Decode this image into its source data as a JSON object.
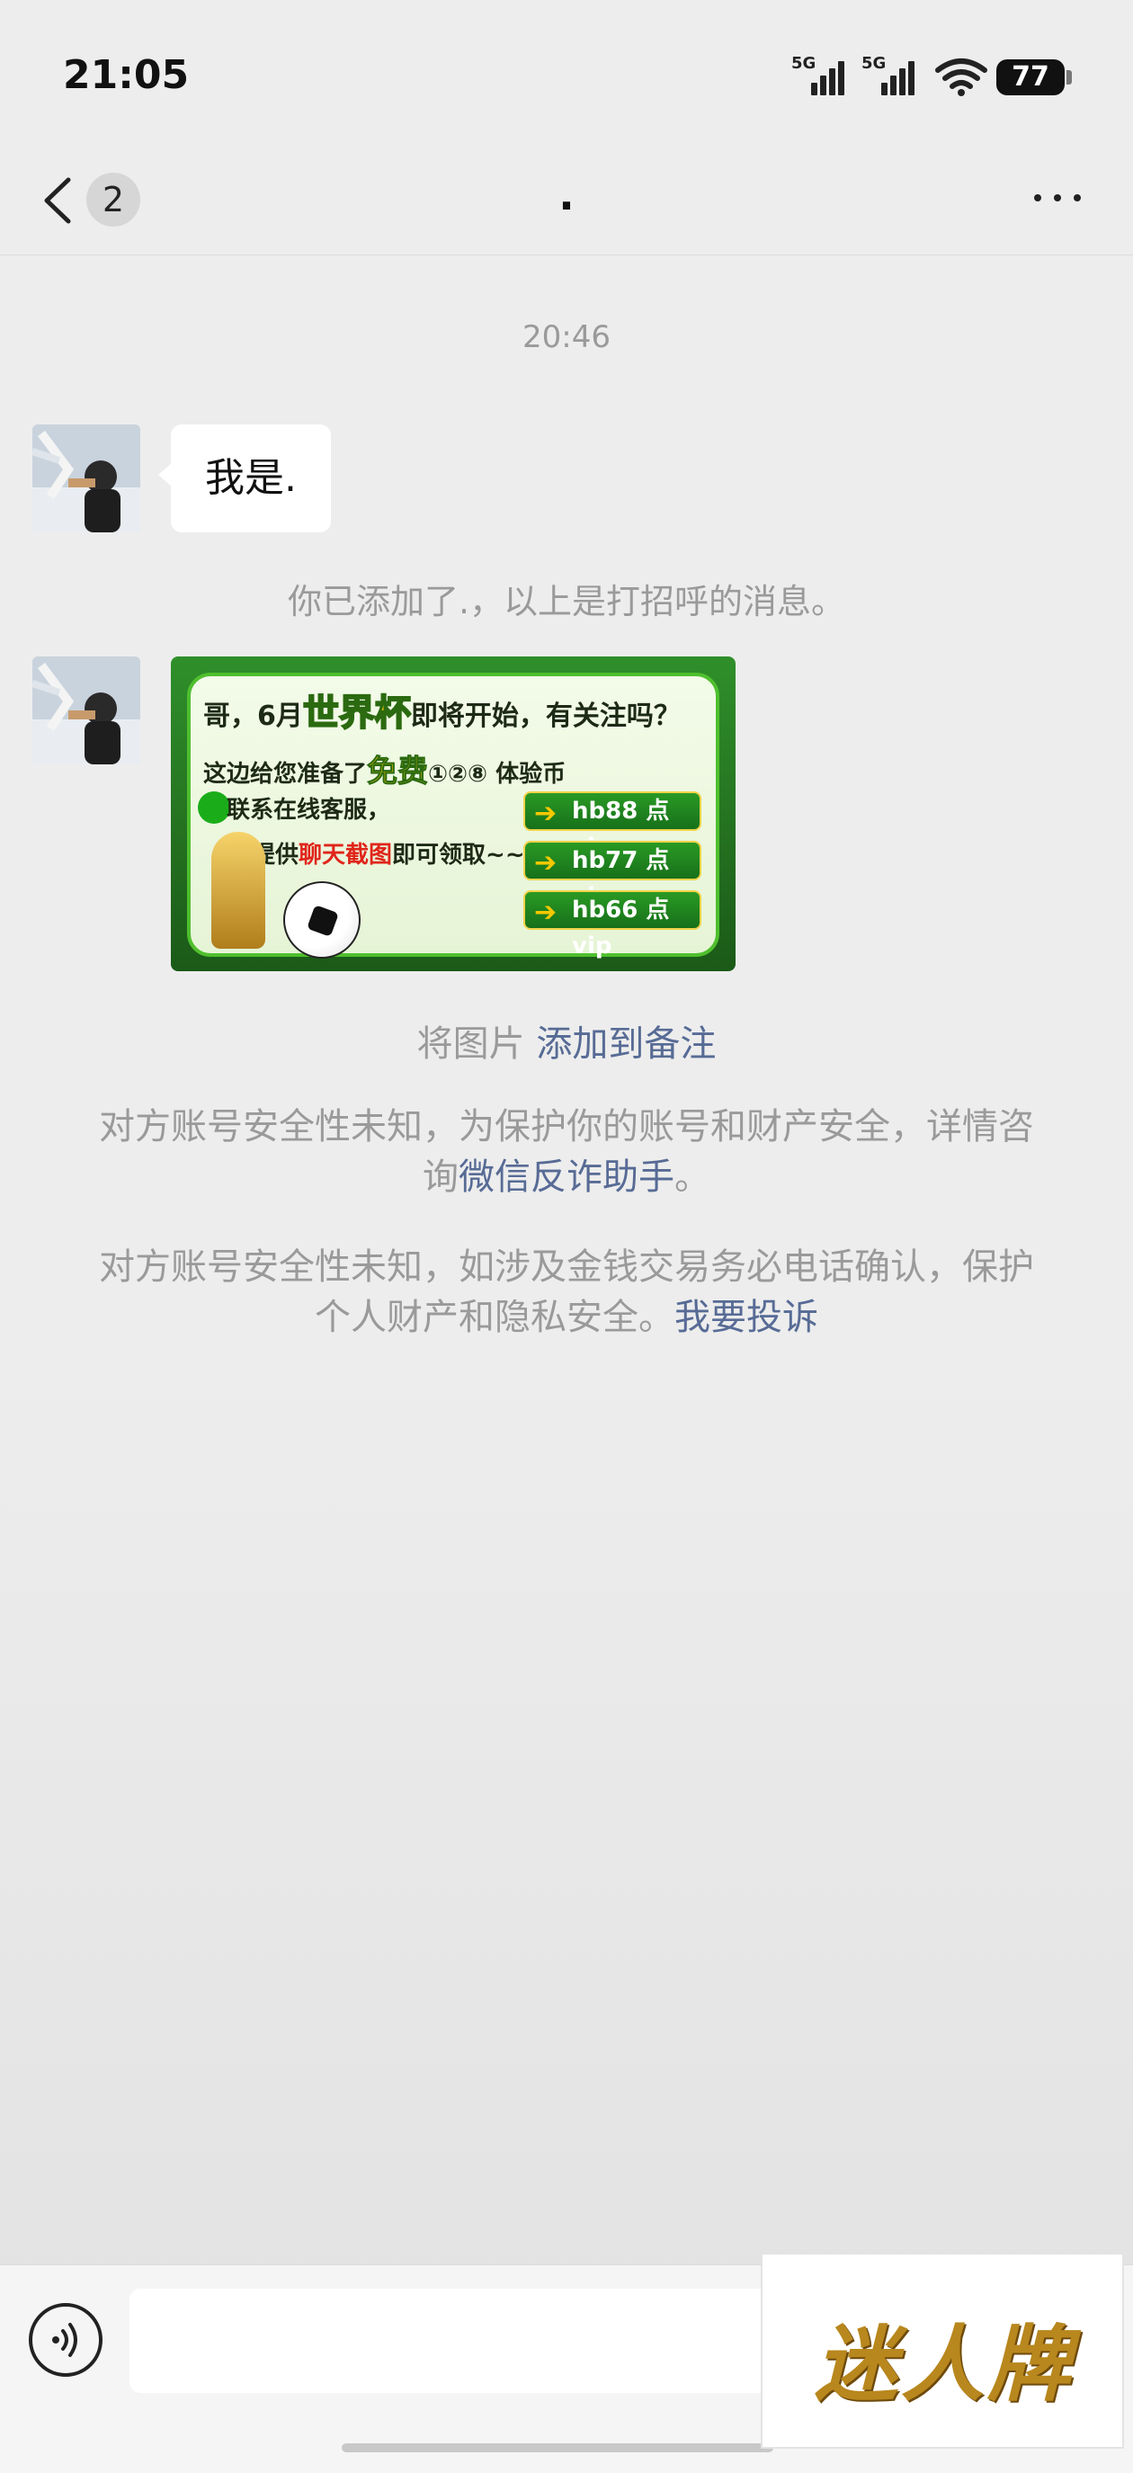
{
  "status_bar": {
    "time": "21:05",
    "network_1": "5G",
    "network_2": "5G",
    "battery": "77"
  },
  "nav": {
    "unread_count": "2",
    "title": "."
  },
  "chat": {
    "timestamp": "20:46",
    "greeting_message": "我是.",
    "added_notice": "你已添加了.，以上是打招呼的消息。",
    "image_card": {
      "line1_prefix": "哥，6月",
      "line1_highlight": "世界杯",
      "line1_suffix": "即将开始，有关注吗？",
      "line2_prefix": "这边给您准备了",
      "line2_highlight": "免费",
      "line2_suffix": "①②⑧ 体验币",
      "line3": "联系在线客服，",
      "line4_prefix": "提供",
      "line4_highlight": "聊天截图",
      "line4_suffix": "即可领取~~",
      "vip_buttons": [
        "hb88 点 vip",
        "hb77 点 vip",
        "hb66 点 vip"
      ]
    },
    "image_caption_prefix": "将图片 ",
    "image_caption_link": "添加到备注",
    "warning1_text": "对方账号安全性未知，为保护你的账号和财产安全，详情咨询",
    "warning1_link": "微信反诈助手",
    "warning1_end": "。",
    "warning2_text": "对方账号安全性未知，如涉及金钱交易务必电话确认，保护个人财产和隐私安全。",
    "warning2_link": "我要投诉"
  },
  "watermark": {
    "text": "迷人牌"
  },
  "colors": {
    "link": "#576b95",
    "background": "#ededed",
    "bubble": "#ffffff",
    "system_text": "#9a9a9a"
  }
}
